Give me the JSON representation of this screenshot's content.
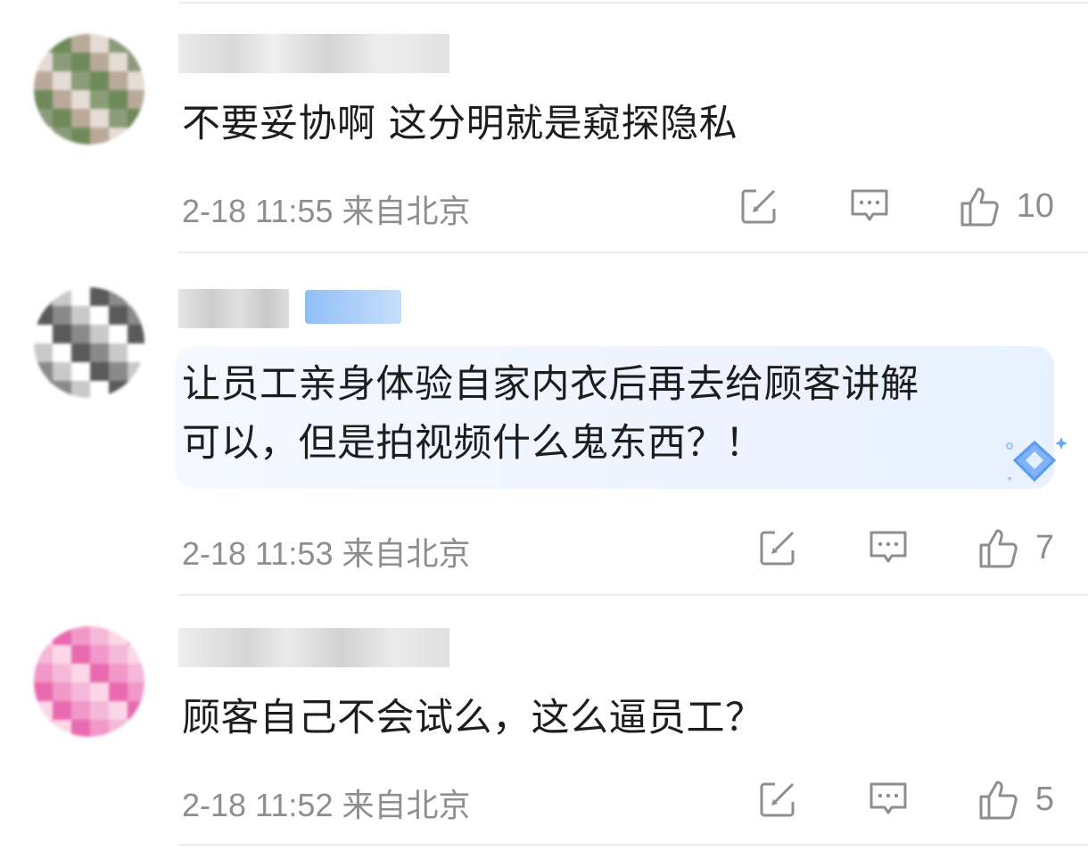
{
  "comments": [
    {
      "text_lines": [
        "不要妥协啊 这分明就是窥探隐私"
      ],
      "time": "2-18 11:55",
      "location": "来自北京",
      "likes": "10",
      "avatar_colors": [
        "#8a9c7a",
        "#6f8a5a",
        "#b9a999",
        "#e5dcd5"
      ]
    },
    {
      "text_lines": [
        "让员工亲身体验自家内衣后再去给顾客讲解",
        "可以，但是拍视频什么鬼东西？！"
      ],
      "time": "2-18 11:53",
      "location": "来自北京",
      "likes": "7",
      "avatar_colors": [
        "#5a5a5a",
        "#8a8a8a",
        "#c9c9c9",
        "#ffffff"
      ]
    },
    {
      "text_lines": [
        "顾客自己不会试么，这么逼员工？"
      ],
      "time": "2-18 11:52",
      "location": "来自北京",
      "likes": "5",
      "avatar_colors": [
        "#f199c9",
        "#f6b8d8",
        "#fbd7e7",
        "#e96ab0"
      ]
    }
  ],
  "icons": {
    "repost": "edit-square-icon",
    "reply": "comment-bubble-icon",
    "like": "thumbs-up-icon",
    "highlight_badge": "blue-diamond-icon"
  },
  "colors": {
    "meta": "#8e8e8e",
    "highlight_bg": "#eef4ff",
    "badge_blue": "#8fbef7"
  }
}
